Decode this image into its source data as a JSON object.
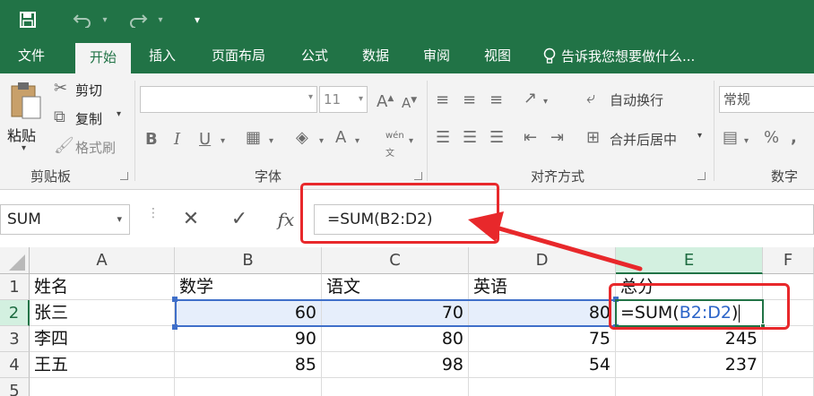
{
  "quick_access": {
    "save_icon": "save-icon",
    "undo_icon": "undo-icon",
    "redo_icon": "redo-icon",
    "customize_icon": "customize-icon"
  },
  "tabs": [
    {
      "label": "文件",
      "active": false
    },
    {
      "label": "开始",
      "active": true
    },
    {
      "label": "插入",
      "active": false
    },
    {
      "label": "页面布局",
      "active": false
    },
    {
      "label": "公式",
      "active": false
    },
    {
      "label": "数据",
      "active": false
    },
    {
      "label": "审阅",
      "active": false
    },
    {
      "label": "视图",
      "active": false
    }
  ],
  "tell_me": "告诉我您想要做什么...",
  "ribbon": {
    "clipboard": {
      "paste": "粘贴",
      "cut": "剪切",
      "copy": "复制",
      "format_painter": "格式刷",
      "group_label": "剪贴板"
    },
    "font": {
      "font_name": "",
      "font_size": "11",
      "phonetic": "wén",
      "group_label": "字体"
    },
    "alignment": {
      "wrap_text": "自动换行",
      "merge_center": "合并后居中",
      "group_label": "对齐方式"
    },
    "number": {
      "format": "常规",
      "group_label": "数字"
    }
  },
  "formula_bar": {
    "name_box": "SUM",
    "formula": "=SUM(B2:D2)",
    "fx": "fx"
  },
  "columns": [
    "A",
    "B",
    "C",
    "D",
    "E",
    "F"
  ],
  "rows": [
    {
      "num": "1",
      "cells": [
        "姓名",
        "数学",
        "语文",
        "英语",
        "总分"
      ]
    },
    {
      "num": "2",
      "cells": [
        "张三",
        "60",
        "70",
        "80",
        ""
      ]
    },
    {
      "num": "3",
      "cells": [
        "李四",
        "90",
        "80",
        "75",
        "245"
      ]
    },
    {
      "num": "4",
      "cells": [
        "王五",
        "85",
        "98",
        "54",
        "237"
      ]
    },
    {
      "num": "5",
      "cells": [
        "",
        "",
        "",
        "",
        ""
      ]
    }
  ],
  "editing_cell": {
    "prefix": "=SUM(",
    "ref": "B2:D2",
    "suffix": ")"
  },
  "colors": {
    "accent": "#217346",
    "annotation": "#e8282b",
    "range_ref": "#2b64c8"
  }
}
